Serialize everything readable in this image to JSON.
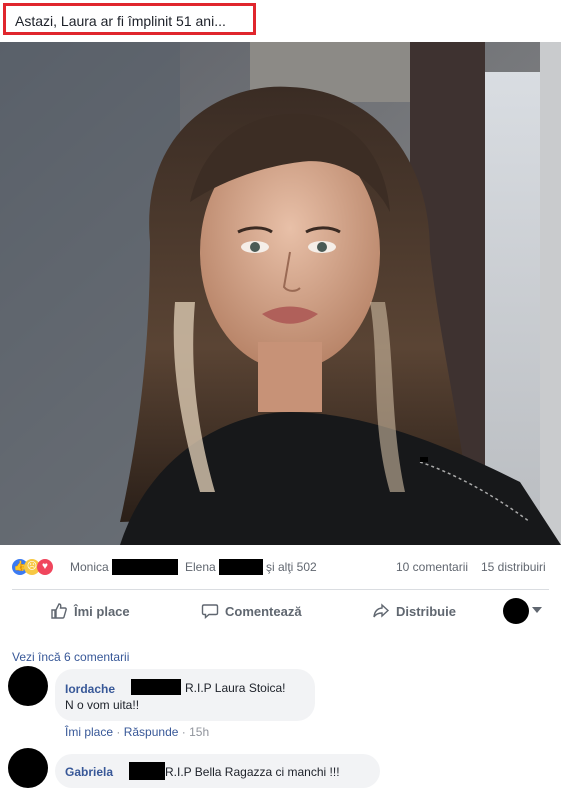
{
  "post": {
    "title": "Astazi, Laura ar fi împlinit 51 ani..."
  },
  "stats": {
    "reactor_1": "Monica",
    "reactor_2": "Elena",
    "others": "şi alţi 502",
    "comments": "10 comentarii",
    "shares": "15 distribuiri",
    "reaction_icons": [
      "like-icon",
      "sad-icon",
      "love-icon"
    ],
    "colors": {
      "like": "#3b7bf3",
      "sad": "#f7c844",
      "love": "#f0465d"
    }
  },
  "actions": {
    "like": "Îmi place",
    "comment": "Comentează",
    "share": "Distribuie"
  },
  "comments": {
    "more_link": "Vezi încă 6 comentarii",
    "items": [
      {
        "author": "Iordache",
        "text_line1": "R.I.P Laura Stoica!",
        "text_line2": "N o vom uita!!",
        "like": "Îmi place",
        "reply": "Răspunde",
        "time": "15h"
      },
      {
        "author": "Gabriela",
        "text_line1": "R.I.P Bella Ragazza ci manchi !!!"
      }
    ]
  }
}
